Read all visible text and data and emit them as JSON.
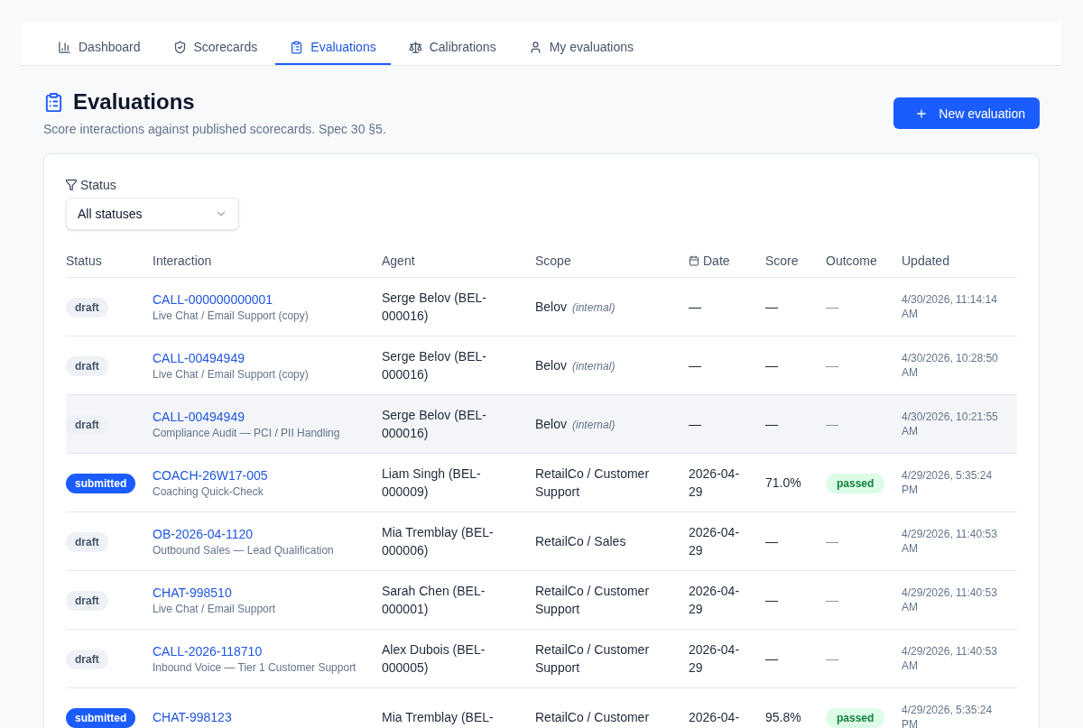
{
  "nav": {
    "tabs": [
      {
        "label": "Dashboard",
        "selected": false
      },
      {
        "label": "Scorecards",
        "selected": false
      },
      {
        "label": "Evaluations",
        "selected": true
      },
      {
        "label": "Calibrations",
        "selected": false
      },
      {
        "label": "My evaluations",
        "selected": false
      }
    ]
  },
  "header": {
    "title": "Evaluations",
    "subtitle": "Score interactions against published scorecards. Spec 30 §5.",
    "new_button": "New evaluation"
  },
  "filter": {
    "label": "Status",
    "select": {
      "value": "All statuses"
    }
  },
  "table": {
    "columns": [
      "Status",
      "Interaction",
      "Agent",
      "Scope",
      "Date",
      "Score",
      "Outcome",
      "Updated"
    ],
    "rows": [
      {
        "highlighted": false,
        "status": {
          "text": "draft",
          "kind": "draft"
        },
        "interaction": {
          "id": "CALL-000000000001",
          "scorecard": "Live Chat / Email Support (copy)"
        },
        "agent": "Serge Belov (BEL-000016)",
        "scope": {
          "name": "Belov",
          "note": "(internal)"
        },
        "date": "—",
        "score": "—",
        "outcome": {
          "text": "—",
          "kind": "empty"
        },
        "updated": "4/30/2026, 11:14:14 AM"
      },
      {
        "highlighted": false,
        "status": {
          "text": "draft",
          "kind": "draft"
        },
        "interaction": {
          "id": "CALL-00494949",
          "scorecard": "Live Chat / Email Support (copy)"
        },
        "agent": "Serge Belov (BEL-000016)",
        "scope": {
          "name": "Belov",
          "note": "(internal)"
        },
        "date": "—",
        "score": "—",
        "outcome": {
          "text": "—",
          "kind": "empty"
        },
        "updated": "4/30/2026, 10:28:50 AM"
      },
      {
        "highlighted": true,
        "status": {
          "text": "draft",
          "kind": "draft"
        },
        "interaction": {
          "id": "CALL-00494949",
          "scorecard": "Compliance Audit — PCI / PII Handling"
        },
        "agent": "Serge Belov (BEL-000016)",
        "scope": {
          "name": "Belov",
          "note": "(internal)"
        },
        "date": "—",
        "score": "—",
        "outcome": {
          "text": "—",
          "kind": "empty"
        },
        "updated": "4/30/2026, 10:21:55 AM"
      },
      {
        "highlighted": false,
        "status": {
          "text": "submitted",
          "kind": "submitted"
        },
        "interaction": {
          "id": "COACH-26W17-005",
          "scorecard": "Coaching Quick-Check"
        },
        "agent": "Liam Singh (BEL-000009)",
        "scope": {
          "name": "RetailCo / Customer Support"
        },
        "date": "2026-04-29",
        "score": "71.0%",
        "outcome": {
          "text": "passed",
          "kind": "passed"
        },
        "updated": "4/29/2026, 5:35:24 PM"
      },
      {
        "highlighted": false,
        "status": {
          "text": "draft",
          "kind": "draft"
        },
        "interaction": {
          "id": "OB-2026-04-1120",
          "scorecard": "Outbound Sales — Lead Qualification"
        },
        "agent": "Mia Tremblay (BEL-000006)",
        "scope": {
          "name": "RetailCo / Sales"
        },
        "date": "2026-04-29",
        "score": "—",
        "outcome": {
          "text": "—",
          "kind": "empty"
        },
        "updated": "4/29/2026, 11:40:53 AM"
      },
      {
        "highlighted": false,
        "status": {
          "text": "draft",
          "kind": "draft"
        },
        "interaction": {
          "id": "CHAT-998510",
          "scorecard": "Live Chat / Email Support"
        },
        "agent": "Sarah Chen (BEL-000001)",
        "scope": {
          "name": "RetailCo / Customer Support"
        },
        "date": "2026-04-29",
        "score": "—",
        "outcome": {
          "text": "—",
          "kind": "empty"
        },
        "updated": "4/29/2026, 11:40:53 AM"
      },
      {
        "highlighted": false,
        "status": {
          "text": "draft",
          "kind": "draft"
        },
        "interaction": {
          "id": "CALL-2026-118710",
          "scorecard": "Inbound Voice — Tier 1 Customer Support"
        },
        "agent": "Alex Dubois (BEL-000005)",
        "scope": {
          "name": "RetailCo / Customer Support"
        },
        "date": "2026-04-29",
        "score": "—",
        "outcome": {
          "text": "—",
          "kind": "empty"
        },
        "updated": "4/29/2026, 11:40:53 AM"
      },
      {
        "highlighted": false,
        "status": {
          "text": "submitted",
          "kind": "submitted"
        },
        "interaction": {
          "id": "CHAT-998123"
        },
        "agent": "Mia Tremblay (BEL-",
        "scope": {
          "name": "RetailCo / Customer"
        },
        "date": "2026-04-",
        "score": "95.8%",
        "outcome": {
          "text": "passed",
          "kind": "passed"
        },
        "updated": "4/29/2026, 5:35:24 PM"
      }
    ]
  }
}
